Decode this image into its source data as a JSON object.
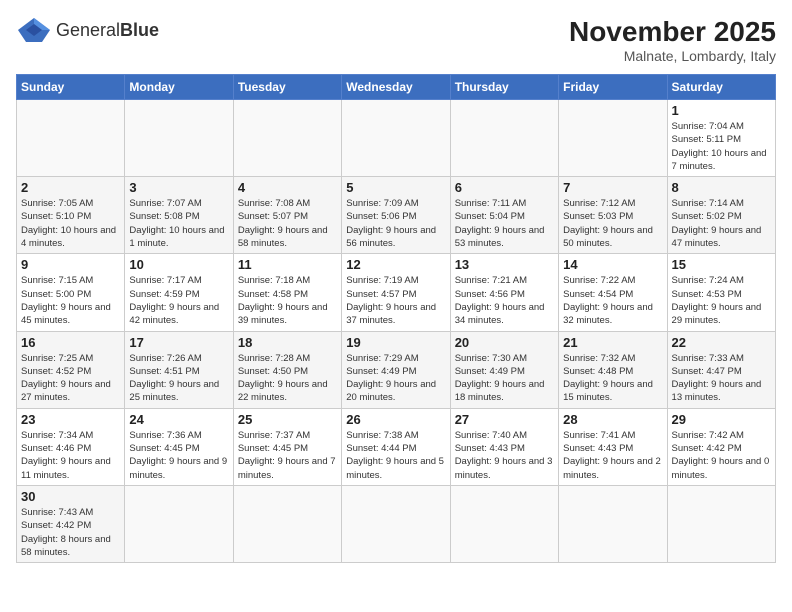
{
  "header": {
    "logo_text_normal": "General",
    "logo_text_bold": "Blue",
    "month_year": "November 2025",
    "location": "Malnate, Lombardy, Italy"
  },
  "weekdays": [
    "Sunday",
    "Monday",
    "Tuesday",
    "Wednesday",
    "Thursday",
    "Friday",
    "Saturday"
  ],
  "weeks": [
    [
      {
        "day": "",
        "info": ""
      },
      {
        "day": "",
        "info": ""
      },
      {
        "day": "",
        "info": ""
      },
      {
        "day": "",
        "info": ""
      },
      {
        "day": "",
        "info": ""
      },
      {
        "day": "",
        "info": ""
      },
      {
        "day": "1",
        "info": "Sunrise: 7:04 AM\nSunset: 5:11 PM\nDaylight: 10 hours and 7 minutes."
      }
    ],
    [
      {
        "day": "2",
        "info": "Sunrise: 7:05 AM\nSunset: 5:10 PM\nDaylight: 10 hours and 4 minutes."
      },
      {
        "day": "3",
        "info": "Sunrise: 7:07 AM\nSunset: 5:08 PM\nDaylight: 10 hours and 1 minute."
      },
      {
        "day": "4",
        "info": "Sunrise: 7:08 AM\nSunset: 5:07 PM\nDaylight: 9 hours and 58 minutes."
      },
      {
        "day": "5",
        "info": "Sunrise: 7:09 AM\nSunset: 5:06 PM\nDaylight: 9 hours and 56 minutes."
      },
      {
        "day": "6",
        "info": "Sunrise: 7:11 AM\nSunset: 5:04 PM\nDaylight: 9 hours and 53 minutes."
      },
      {
        "day": "7",
        "info": "Sunrise: 7:12 AM\nSunset: 5:03 PM\nDaylight: 9 hours and 50 minutes."
      },
      {
        "day": "8",
        "info": "Sunrise: 7:14 AM\nSunset: 5:02 PM\nDaylight: 9 hours and 47 minutes."
      }
    ],
    [
      {
        "day": "9",
        "info": "Sunrise: 7:15 AM\nSunset: 5:00 PM\nDaylight: 9 hours and 45 minutes."
      },
      {
        "day": "10",
        "info": "Sunrise: 7:17 AM\nSunset: 4:59 PM\nDaylight: 9 hours and 42 minutes."
      },
      {
        "day": "11",
        "info": "Sunrise: 7:18 AM\nSunset: 4:58 PM\nDaylight: 9 hours and 39 minutes."
      },
      {
        "day": "12",
        "info": "Sunrise: 7:19 AM\nSunset: 4:57 PM\nDaylight: 9 hours and 37 minutes."
      },
      {
        "day": "13",
        "info": "Sunrise: 7:21 AM\nSunset: 4:56 PM\nDaylight: 9 hours and 34 minutes."
      },
      {
        "day": "14",
        "info": "Sunrise: 7:22 AM\nSunset: 4:54 PM\nDaylight: 9 hours and 32 minutes."
      },
      {
        "day": "15",
        "info": "Sunrise: 7:24 AM\nSunset: 4:53 PM\nDaylight: 9 hours and 29 minutes."
      }
    ],
    [
      {
        "day": "16",
        "info": "Sunrise: 7:25 AM\nSunset: 4:52 PM\nDaylight: 9 hours and 27 minutes."
      },
      {
        "day": "17",
        "info": "Sunrise: 7:26 AM\nSunset: 4:51 PM\nDaylight: 9 hours and 25 minutes."
      },
      {
        "day": "18",
        "info": "Sunrise: 7:28 AM\nSunset: 4:50 PM\nDaylight: 9 hours and 22 minutes."
      },
      {
        "day": "19",
        "info": "Sunrise: 7:29 AM\nSunset: 4:49 PM\nDaylight: 9 hours and 20 minutes."
      },
      {
        "day": "20",
        "info": "Sunrise: 7:30 AM\nSunset: 4:49 PM\nDaylight: 9 hours and 18 minutes."
      },
      {
        "day": "21",
        "info": "Sunrise: 7:32 AM\nSunset: 4:48 PM\nDaylight: 9 hours and 15 minutes."
      },
      {
        "day": "22",
        "info": "Sunrise: 7:33 AM\nSunset: 4:47 PM\nDaylight: 9 hours and 13 minutes."
      }
    ],
    [
      {
        "day": "23",
        "info": "Sunrise: 7:34 AM\nSunset: 4:46 PM\nDaylight: 9 hours and 11 minutes."
      },
      {
        "day": "24",
        "info": "Sunrise: 7:36 AM\nSunset: 4:45 PM\nDaylight: 9 hours and 9 minutes."
      },
      {
        "day": "25",
        "info": "Sunrise: 7:37 AM\nSunset: 4:45 PM\nDaylight: 9 hours and 7 minutes."
      },
      {
        "day": "26",
        "info": "Sunrise: 7:38 AM\nSunset: 4:44 PM\nDaylight: 9 hours and 5 minutes."
      },
      {
        "day": "27",
        "info": "Sunrise: 7:40 AM\nSunset: 4:43 PM\nDaylight: 9 hours and 3 minutes."
      },
      {
        "day": "28",
        "info": "Sunrise: 7:41 AM\nSunset: 4:43 PM\nDaylight: 9 hours and 2 minutes."
      },
      {
        "day": "29",
        "info": "Sunrise: 7:42 AM\nSunset: 4:42 PM\nDaylight: 9 hours and 0 minutes."
      }
    ],
    [
      {
        "day": "30",
        "info": "Sunrise: 7:43 AM\nSunset: 4:42 PM\nDaylight: 8 hours and 58 minutes."
      },
      {
        "day": "",
        "info": ""
      },
      {
        "day": "",
        "info": ""
      },
      {
        "day": "",
        "info": ""
      },
      {
        "day": "",
        "info": ""
      },
      {
        "day": "",
        "info": ""
      },
      {
        "day": "",
        "info": ""
      }
    ]
  ]
}
